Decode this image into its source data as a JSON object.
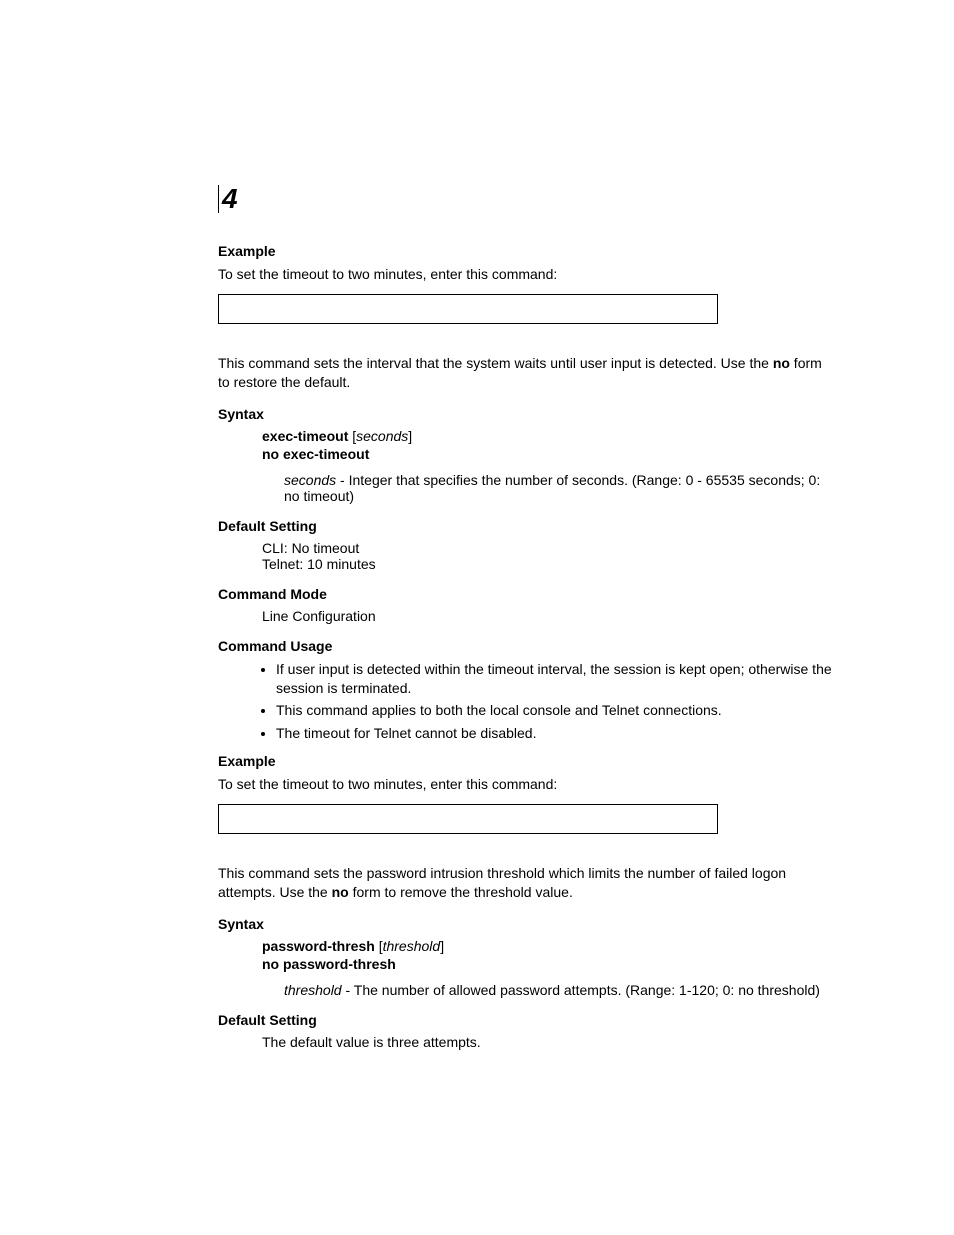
{
  "chapter_number": "4",
  "sec1": {
    "heading": "Example",
    "intro": "To set the timeout to two minutes, enter this command:"
  },
  "cmd1": {
    "desc_pre": "This command sets the interval that the system waits until user input is detected. Use the ",
    "desc_bold": "no",
    "desc_post": " form to restore the default.",
    "syntax_heading": "Syntax",
    "syntax_cmd": "exec-timeout",
    "syntax_param": "seconds",
    "syntax_no": "no exec-timeout",
    "param_name": "seconds",
    "param_desc": " - Integer that specifies the number of seconds. (Range: 0 - 65535 seconds; 0: no timeout)",
    "default_heading": "Default Setting",
    "default_l1": "CLI: No timeout",
    "default_l2": "Telnet: 10 minutes",
    "mode_heading": "Command Mode",
    "mode_val": "Line Configuration",
    "usage_heading": "Command Usage",
    "usage_b1": "If user input is detected within the timeout interval, the session is kept open; otherwise the session is terminated.",
    "usage_b2": "This command applies to both the local console and Telnet connections.",
    "usage_b3": "The timeout for Telnet cannot be disabled.",
    "example_heading": "Example",
    "example_intro": "To set the timeout to two minutes, enter this command:"
  },
  "cmd2": {
    "desc_pre": "This command sets the password intrusion threshold which limits the number of failed logon attempts. Use the ",
    "desc_bold": "no",
    "desc_post": " form to remove the threshold value.",
    "syntax_heading": "Syntax",
    "syntax_cmd": "password-thresh",
    "syntax_param": "threshold",
    "syntax_no": "no password-thresh",
    "param_name": "threshold",
    "param_desc": " - The number of allowed password attempts. (Range: 1-120; 0: no threshold)",
    "default_heading": "Default Setting",
    "default_val": "The default value is three attempts."
  }
}
